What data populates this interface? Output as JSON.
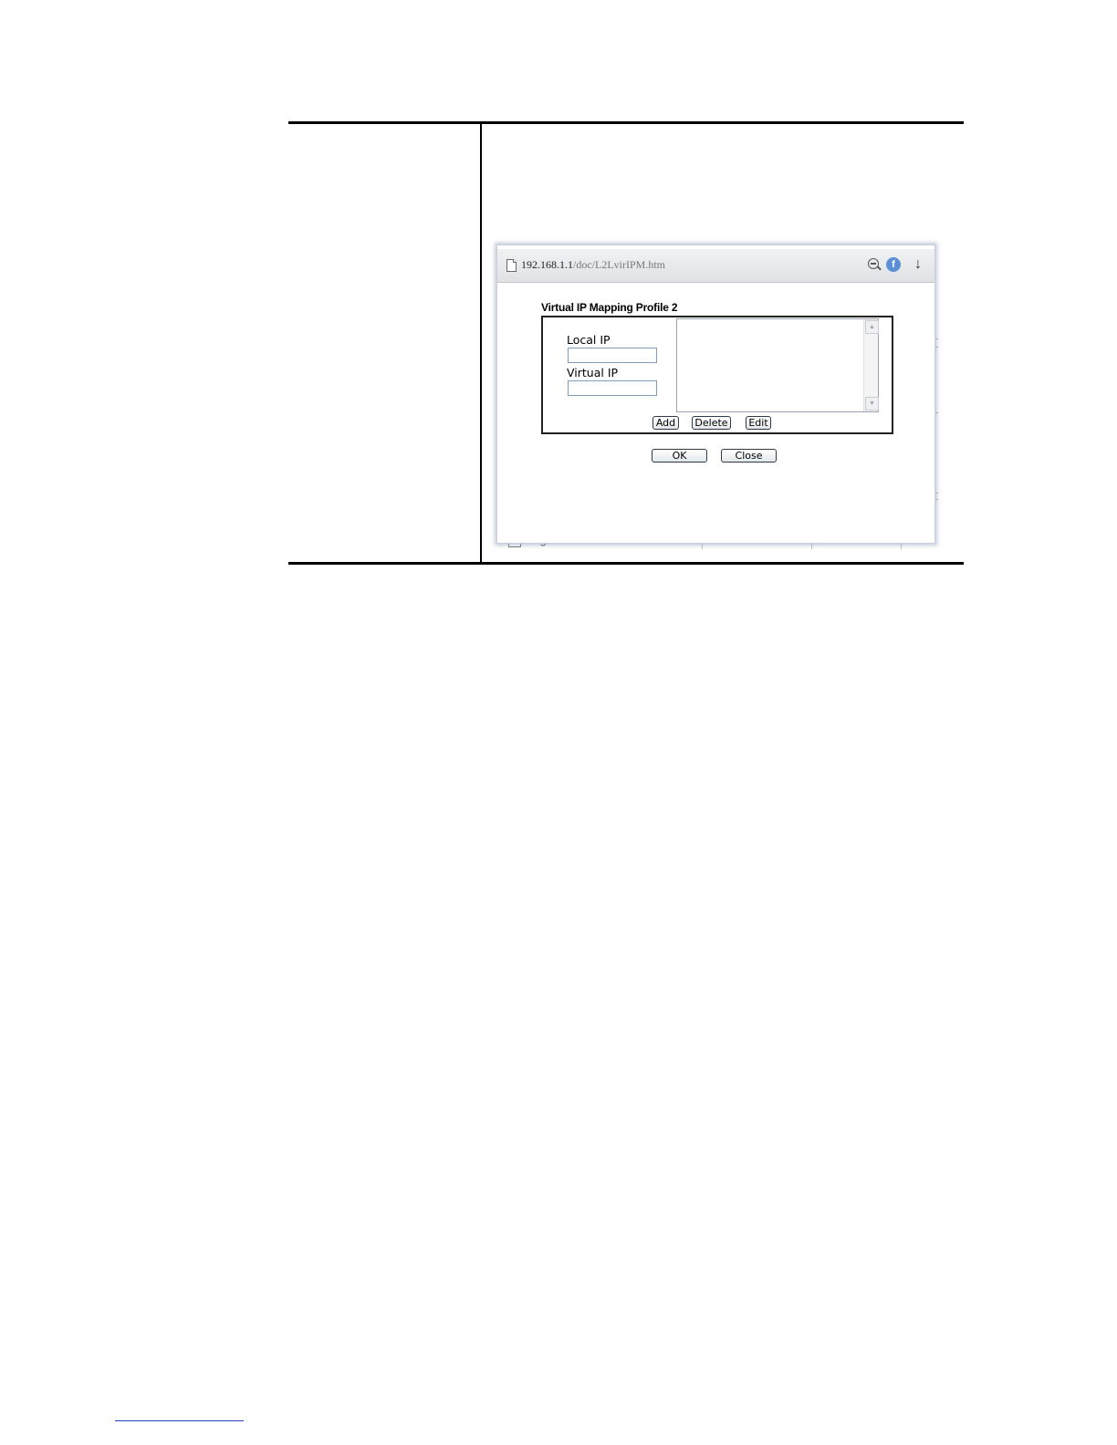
{
  "browser": {
    "url_host": "192.168.1.1",
    "url_path": "/doc/L2LvirIPM.htm",
    "icons": [
      "page-icon",
      "zoom-out-icon",
      "flash-icon",
      "download-icon"
    ]
  },
  "dialog": {
    "title": "Virtual IP Mapping Profile 2",
    "local_ip_label": "Local IP",
    "local_ip_value": "",
    "virtual_ip_label": "Virtual IP",
    "virtual_ip_value": "",
    "mapping_list_items": [],
    "add_label": "Add",
    "delete_label": "Delete",
    "edit_label": "Edit",
    "ok_label": "OK",
    "close_label": "Close"
  },
  "background": {
    "partial_text": "Logical Traffic"
  }
}
